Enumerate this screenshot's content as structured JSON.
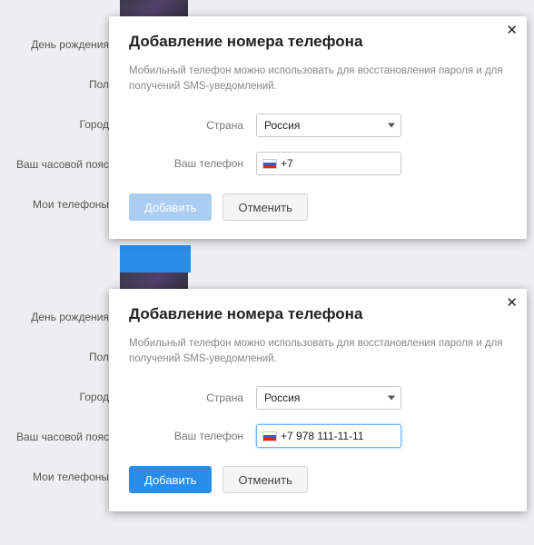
{
  "sidebar": {
    "items": [
      {
        "label": "День рождения"
      },
      {
        "label": "Пол"
      },
      {
        "label": "Город"
      },
      {
        "label": "Ваш часовой пояс"
      },
      {
        "label": "Мои телефоны"
      }
    ]
  },
  "modal1": {
    "title": "Добавление номера телефона",
    "description": "Мобильный телефон можно использовать для восстановления пароля и для получений SMS-уведомлений.",
    "country_label": "Страна",
    "country_value": "Россия",
    "phone_label": "Ваш телефон",
    "phone_value": "+7",
    "add_label": "Добавить",
    "cancel_label": "Отменить",
    "close_glyph": "✕"
  },
  "modal2": {
    "title": "Добавление номера телефона",
    "description": "Мобильный телефон можно использовать для восстановления пароля и для получений SMS-уведомлений.",
    "country_label": "Страна",
    "country_value": "Россия",
    "phone_label": "Ваш телефон",
    "phone_value": "+7 978 111-11-11",
    "add_label": "Добавить",
    "cancel_label": "Отменить",
    "close_glyph": "✕"
  }
}
